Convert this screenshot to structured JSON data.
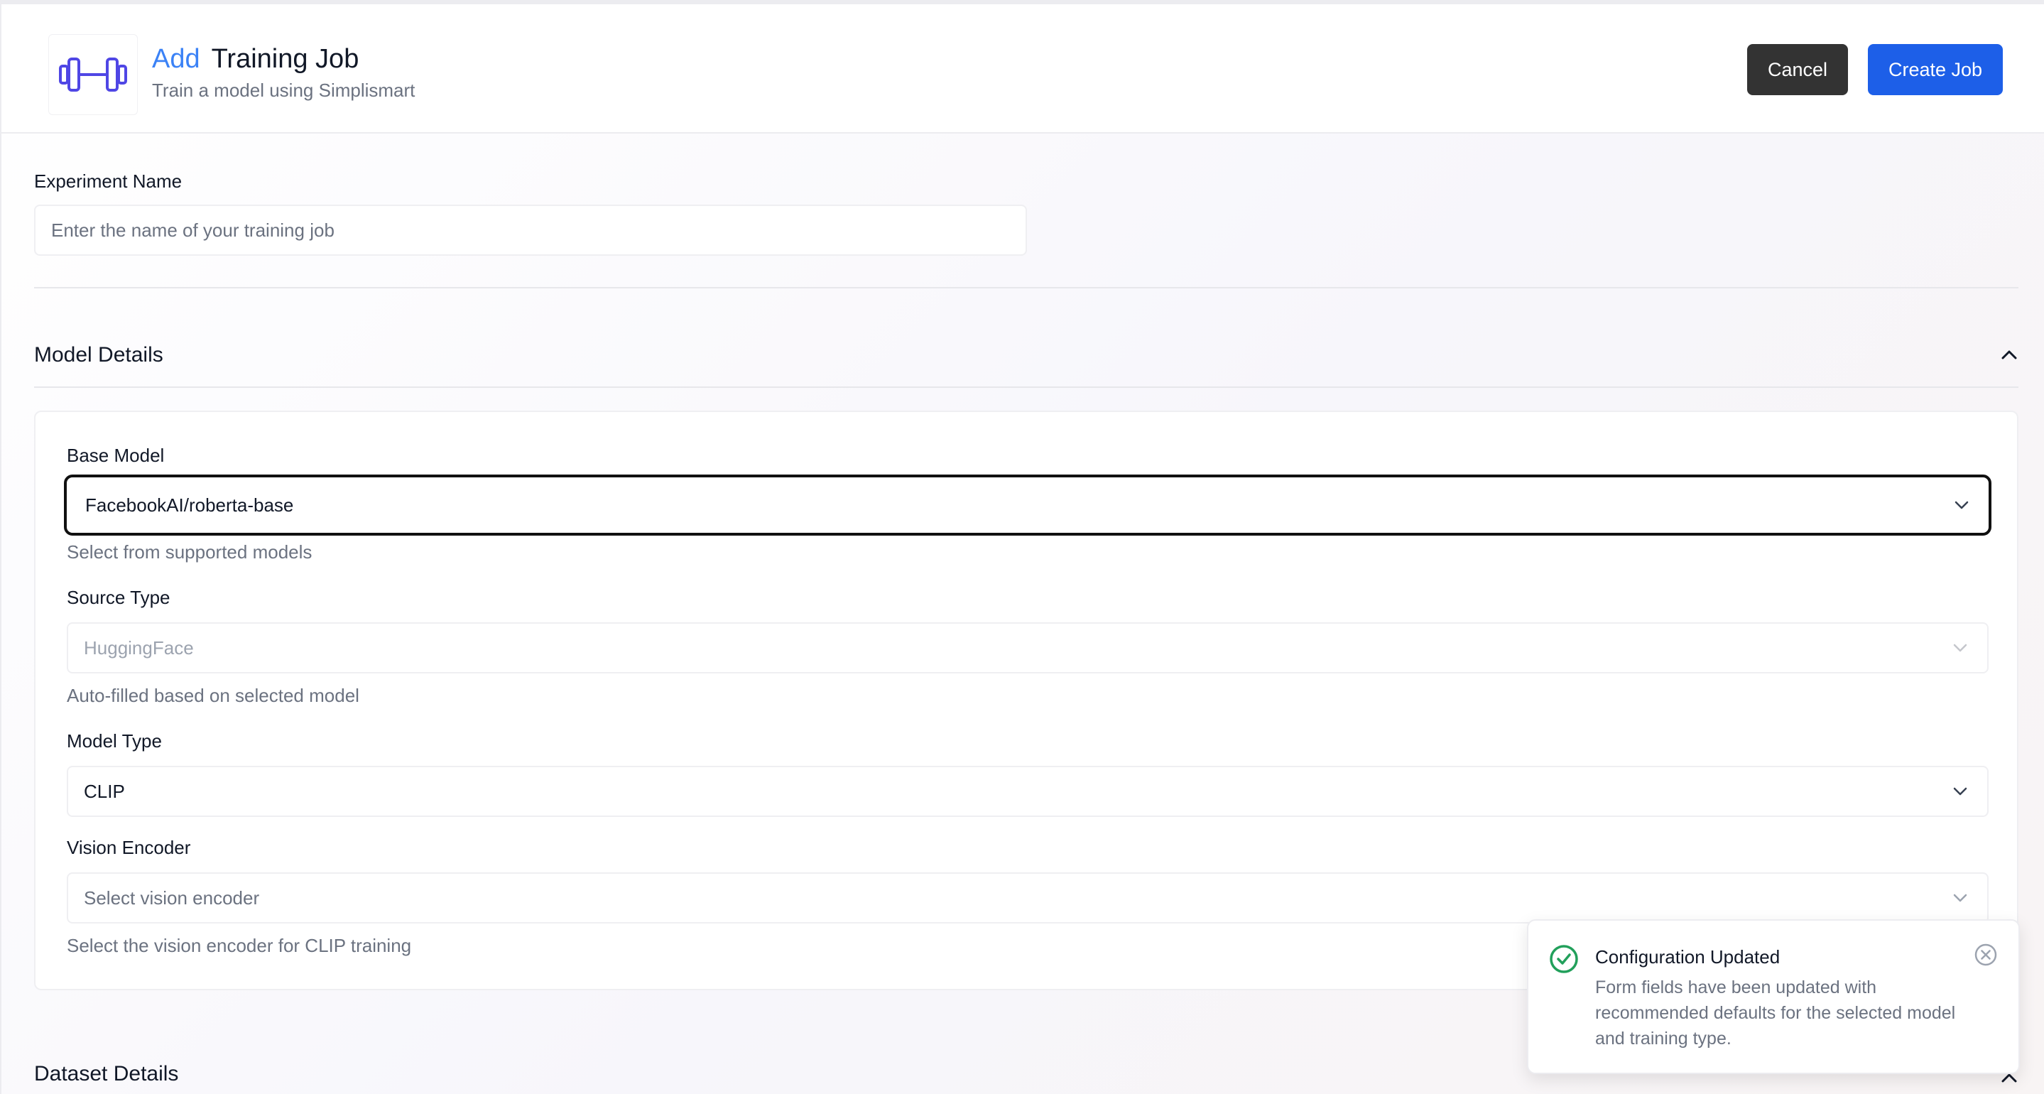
{
  "header": {
    "title_accent": "Add",
    "title": "Training Job",
    "subtitle": "Train a model using Simplismart",
    "logo_icon": "dumbbell-icon",
    "cancel_label": "Cancel",
    "create_label": "Create Job"
  },
  "experiment": {
    "label": "Experiment Name",
    "placeholder": "Enter the name of your training job"
  },
  "model_details": {
    "title": "Model Details",
    "base_model": {
      "label": "Base Model",
      "value": "FacebookAI/roberta-base",
      "help": "Select from supported models"
    },
    "source_type": {
      "label": "Source Type",
      "value": "HuggingFace",
      "help": "Auto-filled based on selected model"
    },
    "model_type": {
      "label": "Model Type",
      "value": "CLIP"
    },
    "vision_encoder": {
      "label": "Vision Encoder",
      "placeholder": "Select vision encoder",
      "help": "Select the vision encoder for CLIP training"
    }
  },
  "dataset_details": {
    "title": "Dataset Details"
  },
  "toast": {
    "title": "Configuration Updated",
    "message": "Form fields have been updated with recommended defaults for the selected model and training type."
  },
  "colors": {
    "accent": "#3b82f6",
    "primary_button": "#1d5fe8",
    "cancel_button": "#333333",
    "success": "#22a05b",
    "logo": "#4f46e5"
  }
}
